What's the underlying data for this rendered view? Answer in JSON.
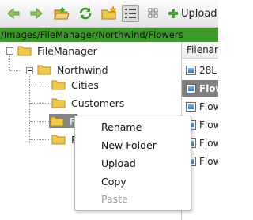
{
  "toolbar": {
    "upload_label": "Upload"
  },
  "address": {
    "path": "/Images/FileManager/Northwind/Flowers"
  },
  "tree": {
    "root": "FileManager",
    "northwind": "Northwind",
    "cities": "Cities",
    "customers": "Customers",
    "flowers_partial": "F",
    "p_partial": "P"
  },
  "files": {
    "header": "Filename",
    "rows": [
      "28L",
      "Flow",
      "Flow",
      "Flow",
      "Flow",
      "Flow"
    ]
  },
  "context_menu": {
    "items": [
      "Rename",
      "New Folder",
      "Upload",
      "Copy",
      "Paste"
    ]
  },
  "colors": {
    "address_bar": "#3d9a2a",
    "selection": "#858585",
    "folder": "#f2c94c"
  }
}
